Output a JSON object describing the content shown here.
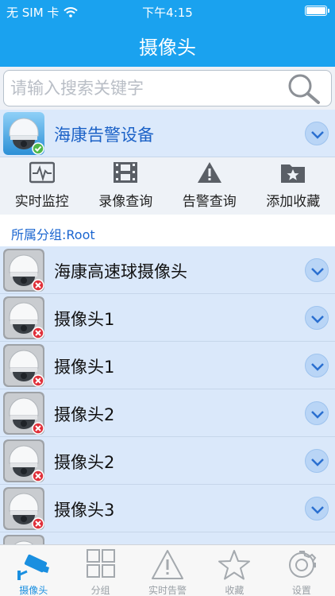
{
  "status_bar": {
    "carrier": "无 SIM 卡",
    "time": "下午4:15",
    "battery_percent": 100
  },
  "nav": {
    "title": "摄像头"
  },
  "search": {
    "placeholder": "请输入搜索关键字"
  },
  "device": {
    "name": "海康告警设备",
    "status": "online"
  },
  "actions": [
    {
      "label": "实时监控",
      "icon": "waveform-icon"
    },
    {
      "label": "录像查询",
      "icon": "film-icon"
    },
    {
      "label": "告警查询",
      "icon": "warning-icon"
    },
    {
      "label": "添加收藏",
      "icon": "folder-star-icon"
    }
  ],
  "group": {
    "text": "所属分组:Root"
  },
  "cameras": [
    {
      "name": "海康高速球摄像头",
      "status": "offline"
    },
    {
      "name": "摄像头1",
      "status": "offline"
    },
    {
      "name": "摄像头1",
      "status": "offline"
    },
    {
      "name": "摄像头2",
      "status": "offline"
    },
    {
      "name": "摄像头2",
      "status": "offline"
    },
    {
      "name": "摄像头3",
      "status": "offline"
    },
    {
      "name": "",
      "status": "offline"
    }
  ],
  "tabs": [
    {
      "label": "摄像头",
      "icon": "camera-icon",
      "active": true
    },
    {
      "label": "分组",
      "icon": "grid-icon",
      "active": false
    },
    {
      "label": "实时告警",
      "icon": "warning-icon",
      "active": false
    },
    {
      "label": "收藏",
      "icon": "star-icon",
      "active": false
    },
    {
      "label": "设置",
      "icon": "gear-icon",
      "active": false
    }
  ],
  "colors": {
    "accent": "#1aa2ef",
    "row_bg": "#dae8fa",
    "online": "#4fb84a",
    "offline": "#e0303a",
    "link": "#1b66d0"
  }
}
